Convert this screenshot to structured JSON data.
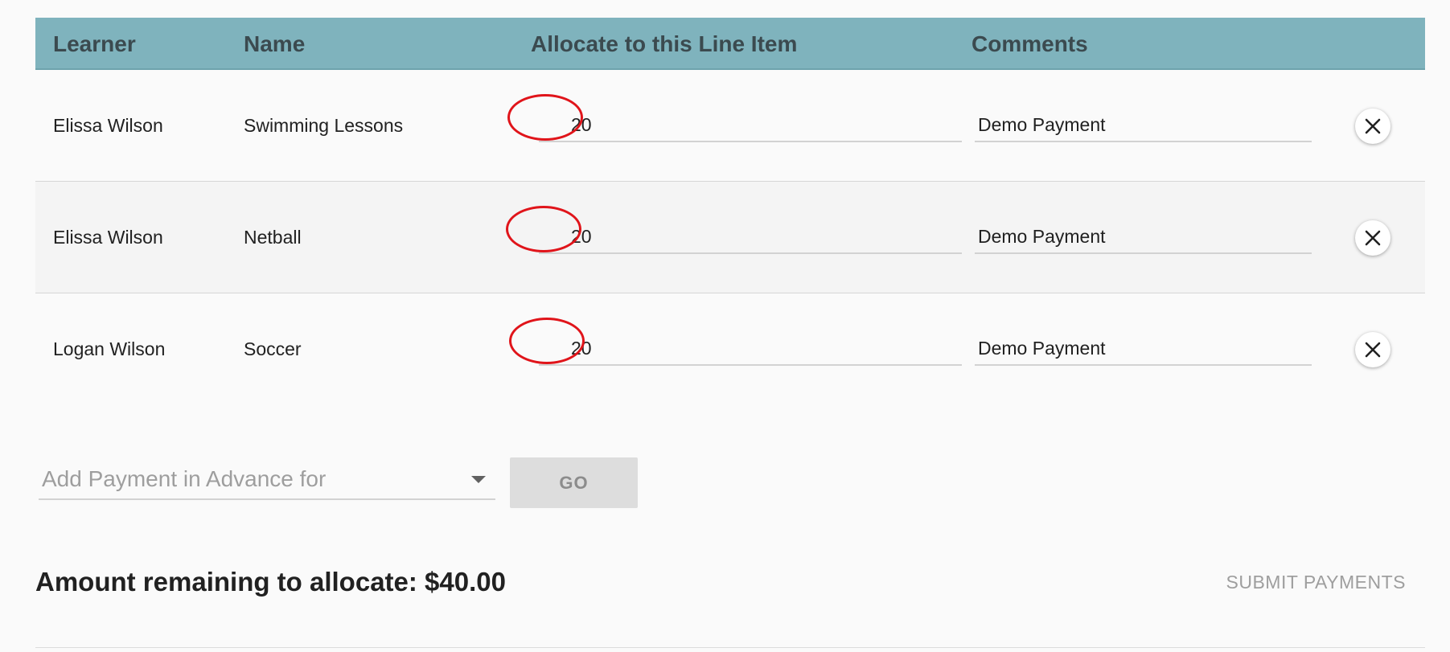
{
  "table": {
    "headers": {
      "learner": "Learner",
      "name": "Name",
      "allocate": "Allocate to this Line Item",
      "comments": "Comments"
    },
    "rows": [
      {
        "learner": "Elissa Wilson",
        "name": "Swimming Lessons",
        "amount": "20",
        "comment": "Demo Payment"
      },
      {
        "learner": "Elissa Wilson",
        "name": "Netball",
        "amount": "20",
        "comment": "Demo Payment"
      },
      {
        "learner": "Logan Wilson",
        "name": "Soccer",
        "amount": "20",
        "comment": "Demo Payment"
      }
    ]
  },
  "advance": {
    "placeholder": "Add Payment in Advance for",
    "go_label": "GO"
  },
  "footer": {
    "remaining_text": "Amount remaining to allocate: $40.00",
    "submit_label": "SUBMIT PAYMENTS"
  },
  "icons": {
    "remove": "close-icon",
    "dropdown": "caret-down-icon"
  },
  "colors": {
    "header_bg": "#7fb3bd",
    "header_text": "#3b4a4f",
    "annotation_circle": "#e0141a",
    "page_bg": "#fafafa"
  }
}
